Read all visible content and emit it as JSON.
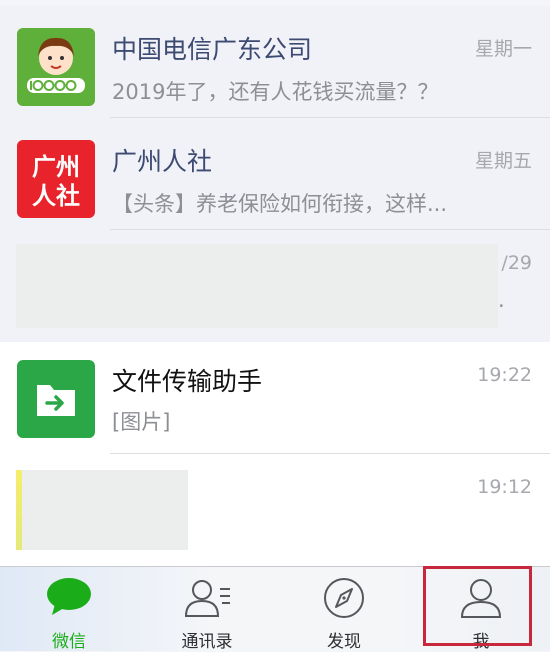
{
  "chats": [
    {
      "name": "中国电信广东公司",
      "preview": "2019年了，还有人花钱买流量？？",
      "time": "星期一",
      "avatar_icon": "china-telecom-10000-mascot-icon"
    },
    {
      "name": "广州人社",
      "preview": "【头条】养老保险如何衔接，这样...",
      "time": "星期五",
      "avatar_icon": "guangzhou-renshe-logo-icon",
      "avatar_text": "广州人社"
    },
    {
      "time_partial": "/29",
      "preview_partial": "."
    },
    {
      "name": "文件传输助手",
      "preview": "[图片]",
      "time": "19:22",
      "avatar_icon": "file-transfer-folder-icon"
    },
    {
      "time": "19:12"
    }
  ],
  "tabbar": {
    "items": [
      {
        "label": "微信",
        "icon": "chat-bubble-icon",
        "active": true
      },
      {
        "label": "通讯录",
        "icon": "contacts-icon"
      },
      {
        "label": "发现",
        "icon": "compass-icon"
      },
      {
        "label": "我",
        "icon": "person-icon",
        "highlighted": true
      }
    ]
  },
  "colors": {
    "accent": "#1aad19",
    "highlight_box": "#c8283b",
    "telecom_green": "#5faf3b",
    "renshe_red": "#e8232c",
    "file_green": "#2ca748"
  }
}
